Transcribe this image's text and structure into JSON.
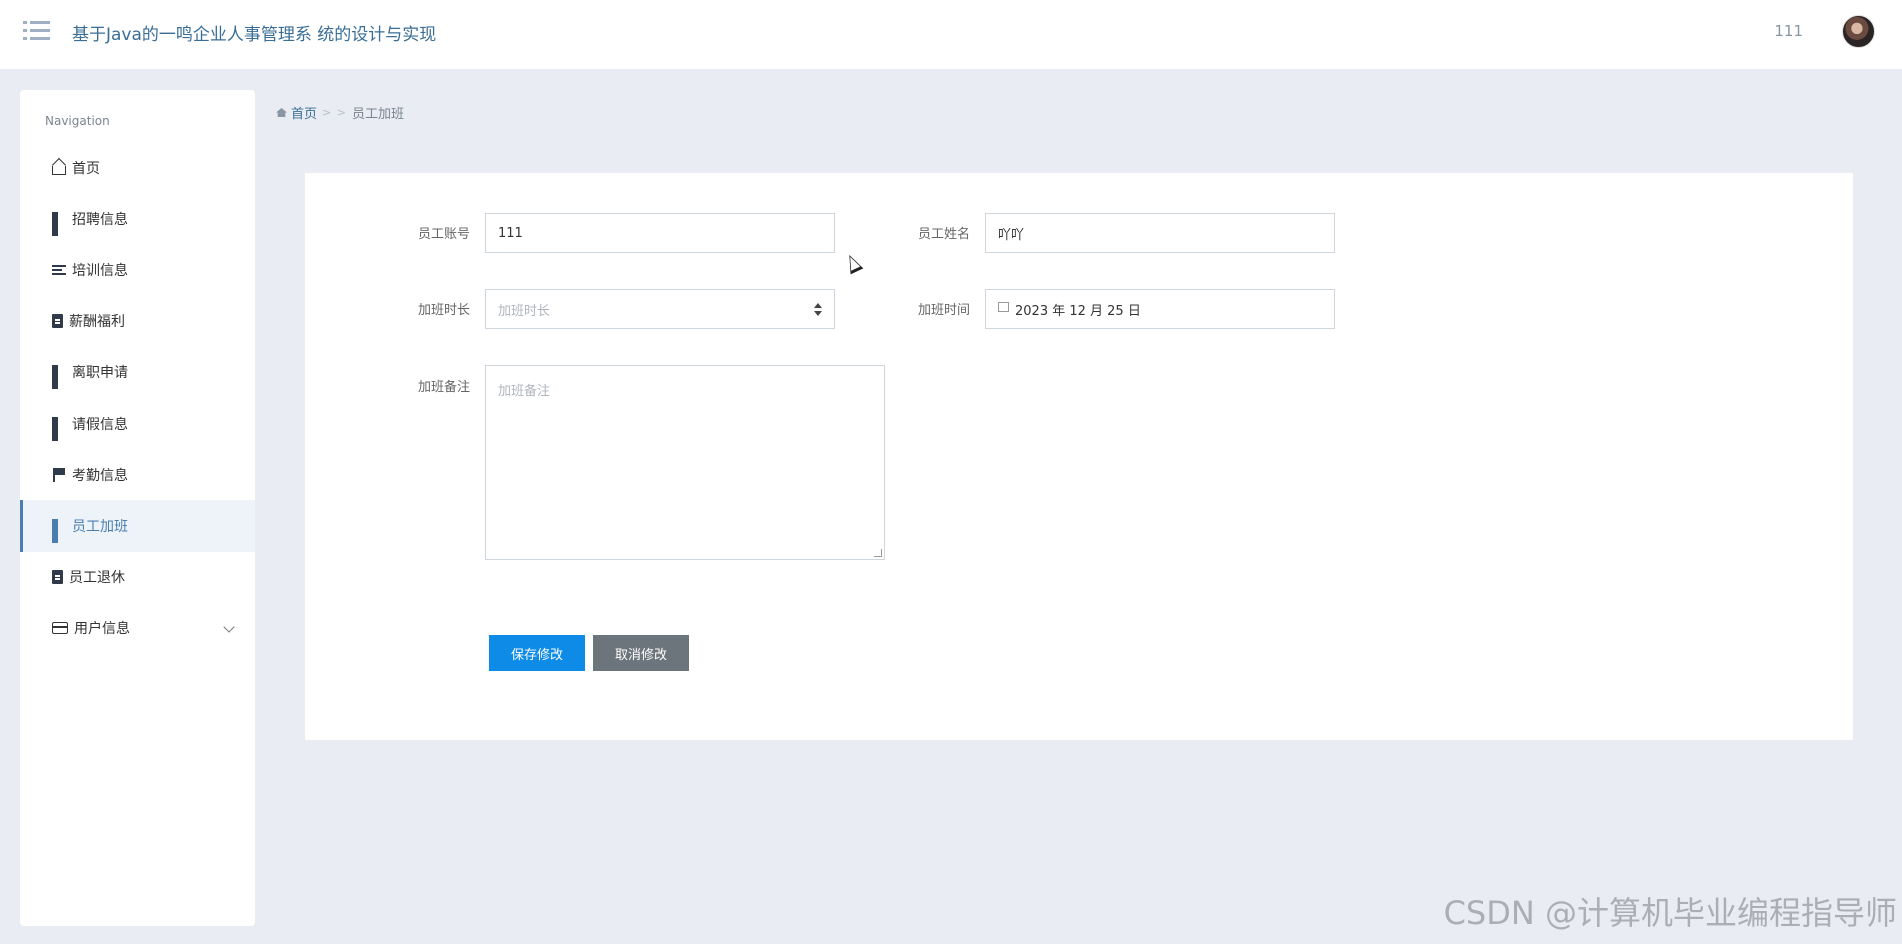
{
  "header": {
    "title": "基于Java的一鸣企业人事管理系 统的设计与实现",
    "user_name": "111"
  },
  "sidebar": {
    "heading": "Navigation",
    "items": [
      {
        "label": "首页",
        "icon": "home-icon"
      },
      {
        "label": "招聘信息",
        "icon": "grid-icon"
      },
      {
        "label": "培训信息",
        "icon": "list-icon"
      },
      {
        "label": "薪酬福利",
        "icon": "clipboard-icon"
      },
      {
        "label": "离职申请",
        "icon": "grid-icon"
      },
      {
        "label": "请假信息",
        "icon": "grid-icon"
      },
      {
        "label": "考勤信息",
        "icon": "flag-icon"
      },
      {
        "label": "员工加班",
        "icon": "grid-icon",
        "active": true
      },
      {
        "label": "员工退休",
        "icon": "clipboard-x-icon"
      },
      {
        "label": "用户信息",
        "icon": "card-icon",
        "expandable": true
      }
    ]
  },
  "breadcrumb": {
    "home": "首页",
    "separator": "> >",
    "current": "员工加班"
  },
  "form": {
    "account_label": "员工账号",
    "account_value": "111",
    "name_label": "员工姓名",
    "name_value": "吖吖",
    "duration_label": "加班时长",
    "duration_placeholder": "加班时长",
    "time_label": "加班时间",
    "time_value": "2023 年 12 月 25 日",
    "remark_label": "加班备注",
    "remark_placeholder": "加班备注",
    "save_label": "保存修改",
    "cancel_label": "取消修改"
  },
  "watermark": "CSDN @计算机毕业编程指导师",
  "colors": {
    "accent": "#0e8be6",
    "cancel": "#6d757c",
    "title": "#3a6e96",
    "background": "#e9ecf3"
  }
}
